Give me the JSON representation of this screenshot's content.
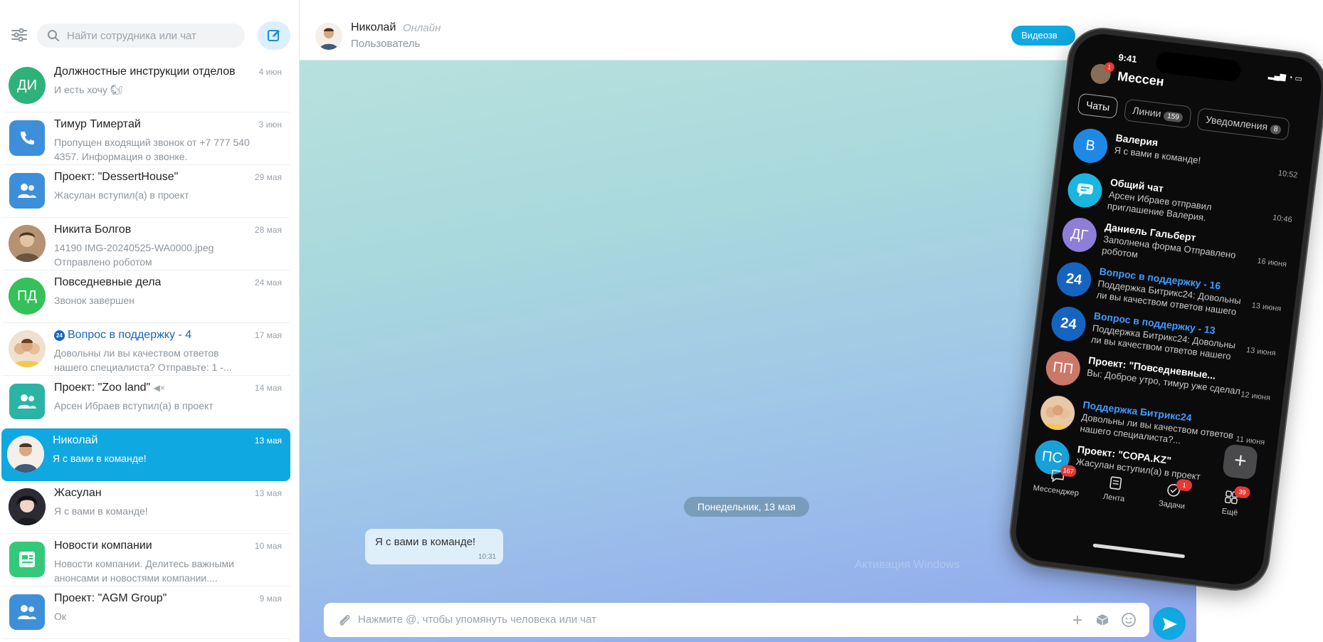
{
  "sidebar": {
    "search_placeholder": "Найти сотрудника или чат",
    "chats": [
      {
        "title": "Должностные инструкции отделов",
        "date": "4 июн",
        "preview": "И есть хочу 🐿",
        "avatar_text": "ДИ",
        "avatar_color": "#2fb27a"
      },
      {
        "title": "Тимур Тимертай",
        "date": "3 июн",
        "preview": "Пропущен входящий звонок от +7 777 540 4357. Информация о звонке.",
        "avatar_text": "",
        "avatar_color": "#3d8fd9"
      },
      {
        "title": "Проект: \"DessertHouse\"",
        "date": "29 мая",
        "preview": "Жасулан вступил(а) в проект",
        "avatar_text": "",
        "avatar_color": "#3d8fd9"
      },
      {
        "title": "Никита Болгов",
        "date": "28 мая",
        "preview": "14190 IMG-20240525-WA0000.jpeg Отправлено роботом",
        "avatar_text": "",
        "avatar_color": "#c7a07a"
      },
      {
        "title": "Повседневные дела",
        "date": "24 мая",
        "preview": "Звонок завершен",
        "avatar_text": "ПД",
        "avatar_color": "#35c05a"
      },
      {
        "title": "Вопрос в поддержку - 4",
        "date": "17 мая",
        "preview": "Довольны ли вы качеством ответов нашего специалиста? Отправьте: 1 -...",
        "avatar_text": "",
        "avatar_color": "#e9c8a8"
      },
      {
        "title": "Проект: \"Zoo land\"",
        "date": "14 мая",
        "preview": "Арсен Ибраев вступил(а) в проект",
        "avatar_text": "",
        "avatar_color": "#2bb3a5"
      },
      {
        "title": "Николай",
        "date": "13 мая",
        "preview": "Я с вами в команде!",
        "avatar_text": "",
        "avatar_color": "#e8ddd0"
      },
      {
        "title": "Жасулан",
        "date": "13 мая",
        "preview": "Я с вами в команде!",
        "avatar_text": "",
        "avatar_color": "#2b2b3a"
      },
      {
        "title": "Новости компании",
        "date": "10 мая",
        "preview": "Новости компании. Делитесь важными анонсами и новостями компании....",
        "avatar_text": "",
        "avatar_color": "#34c97a"
      },
      {
        "title": "Проект: \"AGM Group\"",
        "date": "9 мая",
        "preview": "Ок",
        "avatar_text": "",
        "avatar_color": "#3d8fd9"
      }
    ]
  },
  "header": {
    "name": "Николай",
    "status": "Онлайн",
    "role": "Пользователь",
    "video_label": "Видеозв"
  },
  "chat": {
    "date_divider": "Понедельник, 13 мая",
    "message_text": "Я с вами в команде!",
    "message_time": "10:31",
    "watermark": "Активация Windows",
    "composer_placeholder": "Нажмите @, чтобы упомянуть человека или чат"
  },
  "phone": {
    "time": "9:41",
    "title": "Мессен",
    "user_badge": "1",
    "tabs": [
      {
        "label": "Чаты",
        "count": ""
      },
      {
        "label": "Линии",
        "count": "159"
      },
      {
        "label": "Уведомления",
        "count": "8"
      }
    ],
    "chats": [
      {
        "name": "Валерия",
        "preview": "Я с вами в команде!",
        "time": "10:52",
        "avatar": "В",
        "color": "#1e88e5"
      },
      {
        "name": "Общий чат",
        "preview": "Арсен Ибраев отправил приглашение Валерия.",
        "time": "10:46",
        "avatar": "",
        "color": "#1ab6e0"
      },
      {
        "name": "Даниель Гальберт",
        "preview": "Заполнена форма Отправлено роботом",
        "time": "16 июня",
        "avatar": "ДГ",
        "color": "#8e7ed8"
      },
      {
        "name": "Вопрос в поддержку - 16",
        "preview": "Поддержка Битрикс24: Довольны ли вы качеством ответов нашего специ...",
        "time": "13 июня",
        "avatar": "24",
        "color": "#1565c0"
      },
      {
        "name": "Вопрос в поддержку - 13",
        "preview": "Поддержка Битрикс24: Довольны ли вы качеством ответов нашего специ...",
        "time": "13 июня",
        "avatar": "24",
        "color": "#1565c0"
      },
      {
        "name": "Проект: \"Повседневные...",
        "preview": "Вы: Доброе утро, тимур уже сделал",
        "time": "12 июня",
        "avatar": "ПП",
        "color": "#c9786a"
      },
      {
        "name": "Поддержка Битрикс24",
        "preview": "Довольны ли вы качеством ответов нашего специалиста?...",
        "time": "11 июня",
        "avatar": "",
        "color": "#e9c8a8"
      },
      {
        "name": "Проект: \"COPA.KZ\"",
        "preview": "Жасулан вступил(а) в проект",
        "time": "",
        "avatar": "ПС",
        "color": "#1aa0d8"
      }
    ],
    "nav": [
      {
        "label": "Мессенджер",
        "badge": "167"
      },
      {
        "label": "Лента",
        "badge": ""
      },
      {
        "label": "Задачи",
        "badge": "1"
      },
      {
        "label": "Ещё",
        "badge": "39"
      }
    ]
  }
}
